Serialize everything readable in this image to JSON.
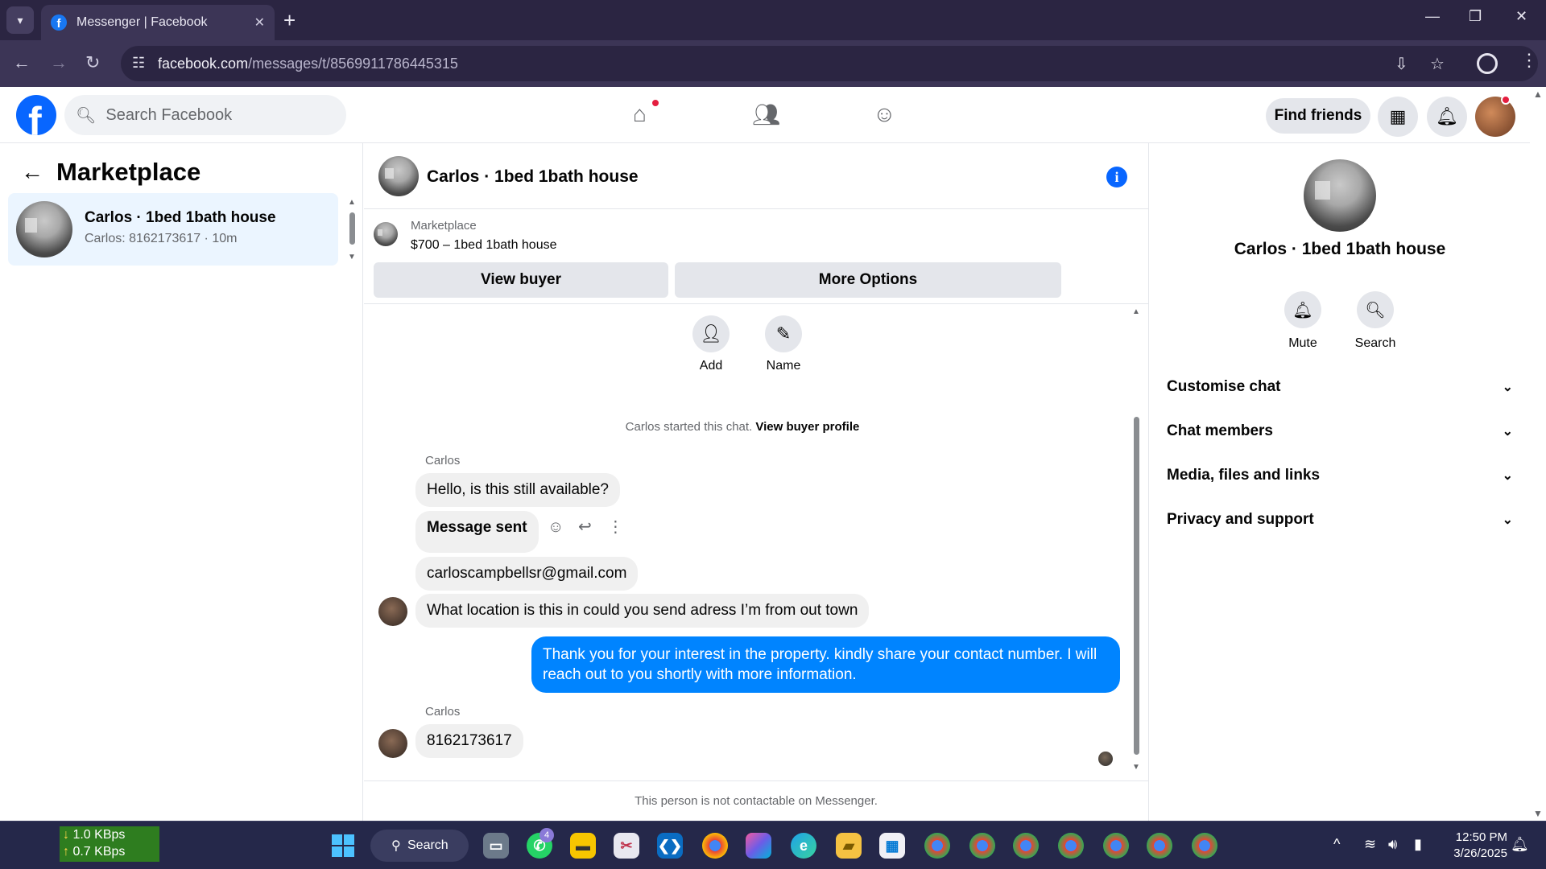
{
  "browser": {
    "tab_title": "Messenger | Facebook",
    "url_domain": "facebook.com",
    "url_path": "/messages/t/8569911786445315"
  },
  "fb": {
    "search_placeholder": "Search Facebook",
    "find_friends": "Find friends"
  },
  "left": {
    "title": "Marketplace",
    "conversation": {
      "name": "Carlos · 1bed 1bath house",
      "preview": "Carlos: 8162173617 · 10m"
    }
  },
  "chat": {
    "title": "Carlos · 1bed 1bath house",
    "marketplace_label": "Marketplace",
    "listing": "$700 – 1bed 1bath house",
    "view_buyer": "View buyer",
    "more_options": "More Options",
    "actions": [
      {
        "label": "Add",
        "icon": "add-person-icon"
      },
      {
        "label": "Name",
        "icon": "pencil-icon"
      }
    ],
    "started_text": "Carlos started this chat.",
    "started_link": "View buyer profile",
    "messages": {
      "sender1": "Carlos",
      "m1": "Hello, is this still available?",
      "m2": "Message sent",
      "m3": "carloscampbellsr@gmail.com",
      "m4": "What location is this in could you send adress I’m from out town",
      "m5": "Thank you for your interest in the property.  kindly share your contact number. I will reach out to you shortly with more information.",
      "sender2": "Carlos",
      "m6": "8162173617"
    },
    "footer": "This person is not contactable on Messenger."
  },
  "right": {
    "name": "Carlos · 1bed 1bath house",
    "mute": "Mute",
    "search": "Search",
    "sections": [
      "Customise chat",
      "Chat members",
      "Media, files and links",
      "Privacy and support"
    ]
  },
  "taskbar": {
    "down_speed": "1.0 KBps",
    "up_speed": "0.7 KBps",
    "search": "Search",
    "whatsapp_badge": "4",
    "time": "12:50 PM",
    "date": "3/26/2025"
  },
  "colors": {
    "fb_blue": "#0866ff",
    "bubble_mine": "#0084ff",
    "selected_conv": "#ebf5ff"
  }
}
